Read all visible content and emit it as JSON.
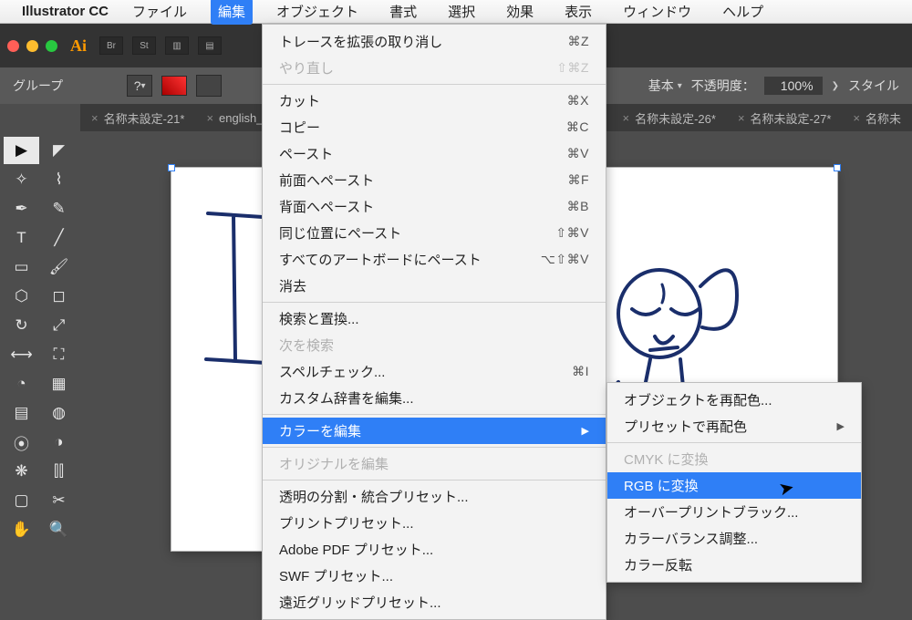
{
  "menubar": {
    "appname": "Illustrator CC",
    "items": [
      "ファイル",
      "編集",
      "オブジェクト",
      "書式",
      "選択",
      "効果",
      "表示",
      "ウィンドウ",
      "ヘルプ"
    ],
    "openIndex": 1
  },
  "controlbar": {
    "group_label": "グループ",
    "basic_label": "基本",
    "opacity_label": "不透明度：",
    "opacity_value": "100%",
    "style_label": "スタイル"
  },
  "tabs": [
    "名称未設定-21*",
    "english_",
    "名称未設定-26*",
    "名称未設定-27*",
    "名称未"
  ],
  "edit_menu": [
    {
      "t": "トレースを拡張の取り消し",
      "sc": "⌘Z"
    },
    {
      "t": "やり直し",
      "sc": "⇧⌘Z",
      "dis": true
    },
    {
      "sep": true
    },
    {
      "t": "カット",
      "sc": "⌘X"
    },
    {
      "t": "コピー",
      "sc": "⌘C"
    },
    {
      "t": "ペースト",
      "sc": "⌘V"
    },
    {
      "t": "前面へペースト",
      "sc": "⌘F"
    },
    {
      "t": "背面へペースト",
      "sc": "⌘B"
    },
    {
      "t": "同じ位置にペースト",
      "sc": "⇧⌘V"
    },
    {
      "t": "すべてのアートボードにペースト",
      "sc": "⌥⇧⌘V"
    },
    {
      "t": "消去"
    },
    {
      "sep": true
    },
    {
      "t": "検索と置換..."
    },
    {
      "t": "次を検索",
      "dis": true
    },
    {
      "t": "スペルチェック...",
      "sc": "⌘I"
    },
    {
      "t": "カスタム辞書を編集..."
    },
    {
      "sep": true
    },
    {
      "t": "カラーを編集",
      "arr": true,
      "hl": true
    },
    {
      "sep": true
    },
    {
      "t": "オリジナルを編集",
      "dis": true
    },
    {
      "sep": true
    },
    {
      "t": "透明の分割・統合プリセット..."
    },
    {
      "t": "プリントプリセット..."
    },
    {
      "t": "Adobe PDF プリセット..."
    },
    {
      "t": "SWF プリセット..."
    },
    {
      "t": "遠近グリッドプリセット..."
    }
  ],
  "sub_menu": [
    {
      "t": "オブジェクトを再配色..."
    },
    {
      "t": "プリセットで再配色",
      "arr": true
    },
    {
      "sep": true
    },
    {
      "t": "CMYK に変換",
      "dis": true
    },
    {
      "t": "RGB に変換",
      "hl": true
    },
    {
      "t": "オーバープリントブラック..."
    },
    {
      "t": "カラーバランス調整..."
    },
    {
      "t": "カラー反転"
    }
  ]
}
